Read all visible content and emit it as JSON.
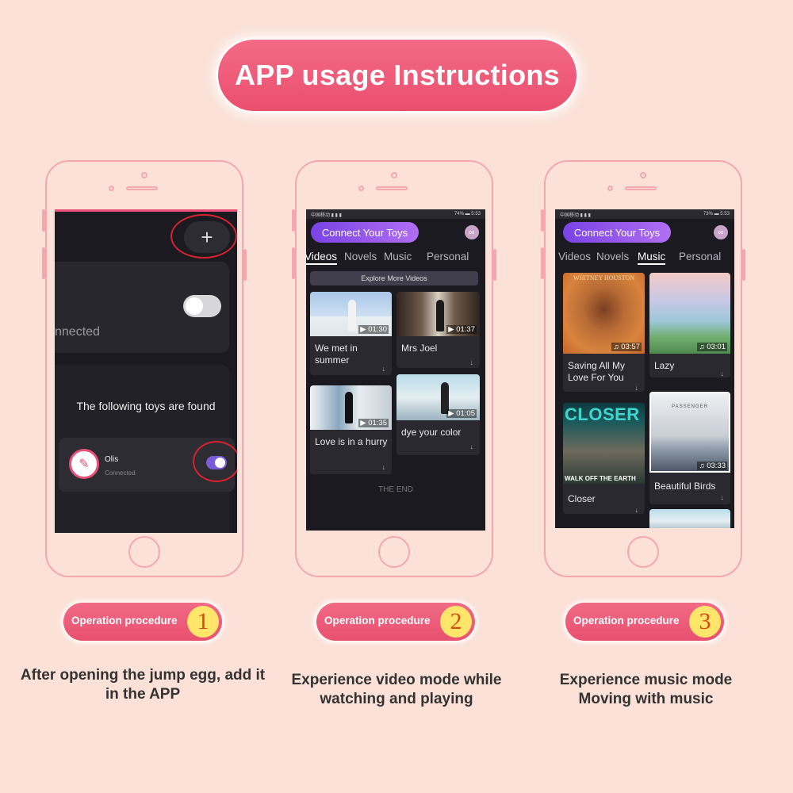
{
  "title": "APP usage Instructions",
  "steps": [
    {
      "badge": "Operation procedure",
      "number": "1",
      "description": "After opening the jump egg, add it in the APP"
    },
    {
      "badge": "Operation procedure",
      "number": "2",
      "description": "Experience video mode while watching and playing"
    },
    {
      "badge": "Operation procedure",
      "number": "3",
      "description": "Experience music mode Moving with music"
    }
  ],
  "phone1": {
    "plus_icon": "plus-icon",
    "connected_text": "nnected",
    "found_text": "The following toys are found",
    "toy_name": "Olis",
    "toy_status": "Connected"
  },
  "phone2": {
    "status_left": "中国移动 ▮ ▮ ▮",
    "status_right": "74% ▬ 5:53",
    "connect_button": "Connect Your Toys",
    "tabs": [
      "Videos",
      "Novels",
      "Music",
      "Personal"
    ],
    "active_tab": "Videos",
    "explore_button": "Explore More Videos",
    "videos": [
      {
        "title": "We met in summer",
        "duration": "▶ 01:30"
      },
      {
        "title": "Mrs Joel",
        "duration": "▶ 01:37"
      },
      {
        "title": "Love is in a hurry",
        "duration": "▶ 01:35"
      },
      {
        "title": "dye your color",
        "duration": "▶ 01:05"
      }
    ],
    "end_text": "THE END"
  },
  "phone3": {
    "status_left": "中国移动 ▮ ▮ ▮",
    "status_right": "73% ▬ 5:53",
    "connect_button": "Connect Your Toys",
    "tabs": [
      "Videos",
      "Novels",
      "Music",
      "Personal"
    ],
    "active_tab": "Music",
    "songs": [
      {
        "title": "Saving All My Love For You",
        "duration": "♫ 03:57",
        "cover_text": "WHITNEY HOUSTON"
      },
      {
        "title": "Lazy",
        "duration": "♫ 03:01",
        "cover_text": ""
      },
      {
        "title": "Closer",
        "duration": "",
        "cover_text": "CLOSER"
      },
      {
        "title": "Beautiful Birds",
        "duration": "♫ 03:33",
        "cover_text": "PASSENGER"
      }
    ],
    "closer_subtext": "WALK OFF THE EARTH"
  },
  "colors": {
    "background": "#fbe1d8",
    "accent_pink": "#ea4f6f",
    "phone_outline": "#f4a7b0",
    "app_purple": "#8a4eea",
    "badge_yellow": "#ffe66b"
  }
}
